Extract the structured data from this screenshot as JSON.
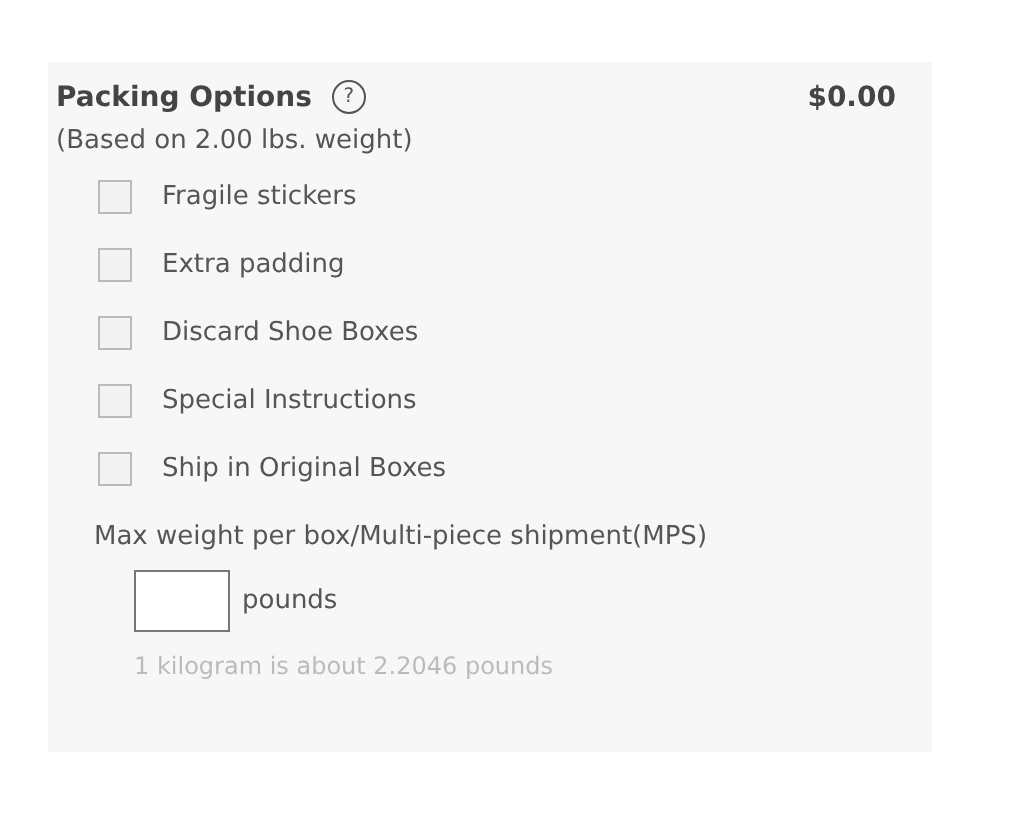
{
  "section": {
    "title": "Packing Options",
    "help_icon": "?",
    "price": "$0.00",
    "subtitle": "(Based on 2.00 lbs. weight)"
  },
  "options": [
    {
      "label": "Fragile stickers",
      "checked": false
    },
    {
      "label": "Extra padding",
      "checked": false
    },
    {
      "label": "Discard Shoe Boxes",
      "checked": false
    },
    {
      "label": "Special Instructions",
      "checked": false
    },
    {
      "label": "Ship in Original Boxes",
      "checked": false
    }
  ],
  "max_weight": {
    "label": "Max weight per box/Multi-piece shipment(MPS)",
    "unit": "pounds",
    "hint": "1 kilogram is about 2.2046 pounds"
  }
}
